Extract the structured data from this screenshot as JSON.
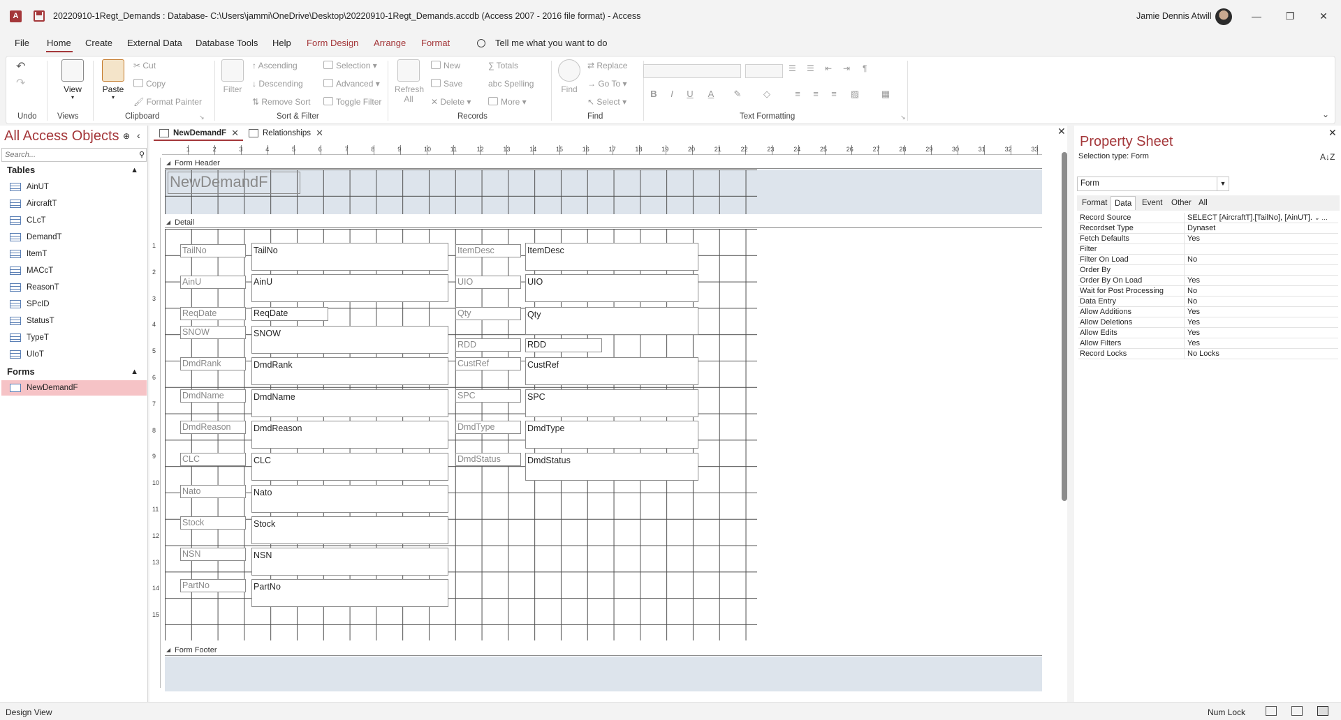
{
  "titlebar": {
    "app_icon_letter": "A",
    "title": "20220910-1Regt_Demands : Database- C:\\Users\\jammi\\OneDrive\\Desktop\\20220910-1Regt_Demands.accdb (Access 2007 - 2016 file format) - Access",
    "user": "Jamie Dennis Atwill",
    "minimize": "—",
    "restore": "❐",
    "close": "✕"
  },
  "menu": {
    "file": "File",
    "home": "Home",
    "create": "Create",
    "external_data": "External Data",
    "database_tools": "Database Tools",
    "help": "Help",
    "form_design": "Form Design",
    "arrange": "Arrange",
    "format": "Format",
    "tell_me": "Tell me what you want to do"
  },
  "ribbon": {
    "groups": {
      "undo": "Undo",
      "views": "Views",
      "clipboard": "Clipboard",
      "sort_filter": "Sort & Filter",
      "records": "Records",
      "find": "Find",
      "text_formatting": "Text Formatting"
    },
    "view": "View",
    "paste": "Paste",
    "cut": "Cut",
    "copy": "Copy",
    "format_painter": "Format Painter",
    "filter": "Filter",
    "ascending": "Ascending",
    "descending": "Descending",
    "remove_sort": "Remove Sort",
    "selection": "Selection",
    "advanced": "Advanced",
    "toggle_filter": "Toggle Filter",
    "refresh_all_1": "Refresh",
    "refresh_all_2": "All",
    "new": "New",
    "save": "Save",
    "delete": "Delete",
    "totals": "Totals",
    "spelling": "Spelling",
    "more": "More",
    "find": "Find",
    "replace": "Replace",
    "go_to": "Go To",
    "select": "Select",
    "bold": "B",
    "italic": "I",
    "underline": "U",
    "font_color": "A"
  },
  "nav": {
    "title": "All Access Objects",
    "search_placeholder": "Search...",
    "tables_header": "Tables",
    "tables": [
      "AinUT",
      "AircraftT",
      "CLcT",
      "DemandT",
      "ItemT",
      "MACcT",
      "ReasonT",
      "SPcID",
      "StatusT",
      "TypeT",
      "UIoT"
    ],
    "forms_header": "Forms",
    "forms": [
      "NewDemandF"
    ]
  },
  "doc": {
    "tabs": [
      "NewDemandF",
      "Relationships"
    ],
    "sections": {
      "header": "Form Header",
      "detail": "Detail",
      "footer": "Form Footer"
    },
    "form_title": "NewDemandF",
    "left_labels": [
      "TailNo",
      "AinU",
      "ReqDate",
      "SNOW",
      "DmdRank",
      "DmdName",
      "DmdReason",
      "CLC",
      "Nato",
      "Stock",
      "NSN",
      "PartNo"
    ],
    "left_fields": [
      "TailNo",
      "AinU",
      "ReqDate",
      "SNOW",
      "DmdRank",
      "DmdName",
      "DmdReason",
      "CLC",
      "Nato",
      "Stock",
      "NSN",
      "PartNo"
    ],
    "right_labels": [
      "ItemDesc",
      "UIO",
      "Qty",
      "RDD",
      "CustRef",
      "SPC",
      "DmdType",
      "DmdStatus"
    ],
    "right_fields": [
      "ItemDesc",
      "UIO",
      "Qty",
      "RDD",
      "CustRef",
      "SPC",
      "DmdType",
      "DmdStatus"
    ],
    "hruler_numbers": [
      "1",
      "2",
      "3",
      "4",
      "5",
      "6",
      "7",
      "8",
      "9",
      "10",
      "11",
      "12",
      "13",
      "14",
      "15",
      "16",
      "17",
      "18",
      "19",
      "20",
      "21",
      "22",
      "23",
      "24",
      "25",
      "26",
      "27",
      "28",
      "29",
      "30",
      "31",
      "32",
      "33"
    ],
    "vruler_numbers": [
      "1",
      "2",
      "3",
      "4",
      "5",
      "6",
      "7",
      "8",
      "9",
      "10",
      "11",
      "12",
      "13",
      "14",
      "15"
    ]
  },
  "property_sheet": {
    "title": "Property Sheet",
    "selection_type": "Selection type:  Form",
    "sort_icon": "A↓Z",
    "object": "Form",
    "tabs": [
      "Format",
      "Data",
      "Event",
      "Other",
      "All"
    ],
    "active_tab": "Data",
    "properties": [
      {
        "name": "Record Source",
        "value": "SELECT [AircraftT].[TailNo], [AinUT]."
      },
      {
        "name": "Recordset Type",
        "value": "Dynaset"
      },
      {
        "name": "Fetch Defaults",
        "value": "Yes"
      },
      {
        "name": "Filter",
        "value": ""
      },
      {
        "name": "Filter On Load",
        "value": "No"
      },
      {
        "name": "Order By",
        "value": ""
      },
      {
        "name": "Order By On Load",
        "value": "Yes"
      },
      {
        "name": "Wait for Post Processing",
        "value": "No"
      },
      {
        "name": "Data Entry",
        "value": "No"
      },
      {
        "name": "Allow Additions",
        "value": "Yes"
      },
      {
        "name": "Allow Deletions",
        "value": "Yes"
      },
      {
        "name": "Allow Edits",
        "value": "Yes"
      },
      {
        "name": "Allow Filters",
        "value": "Yes"
      },
      {
        "name": "Record Locks",
        "value": "No Locks"
      }
    ]
  },
  "status": {
    "mode": "Design View",
    "num_lock": "Num Lock"
  },
  "colors": {
    "accent": "#a4373a",
    "grid_bg": "#dde4ec",
    "selected_nav": "#f6c3c6"
  }
}
